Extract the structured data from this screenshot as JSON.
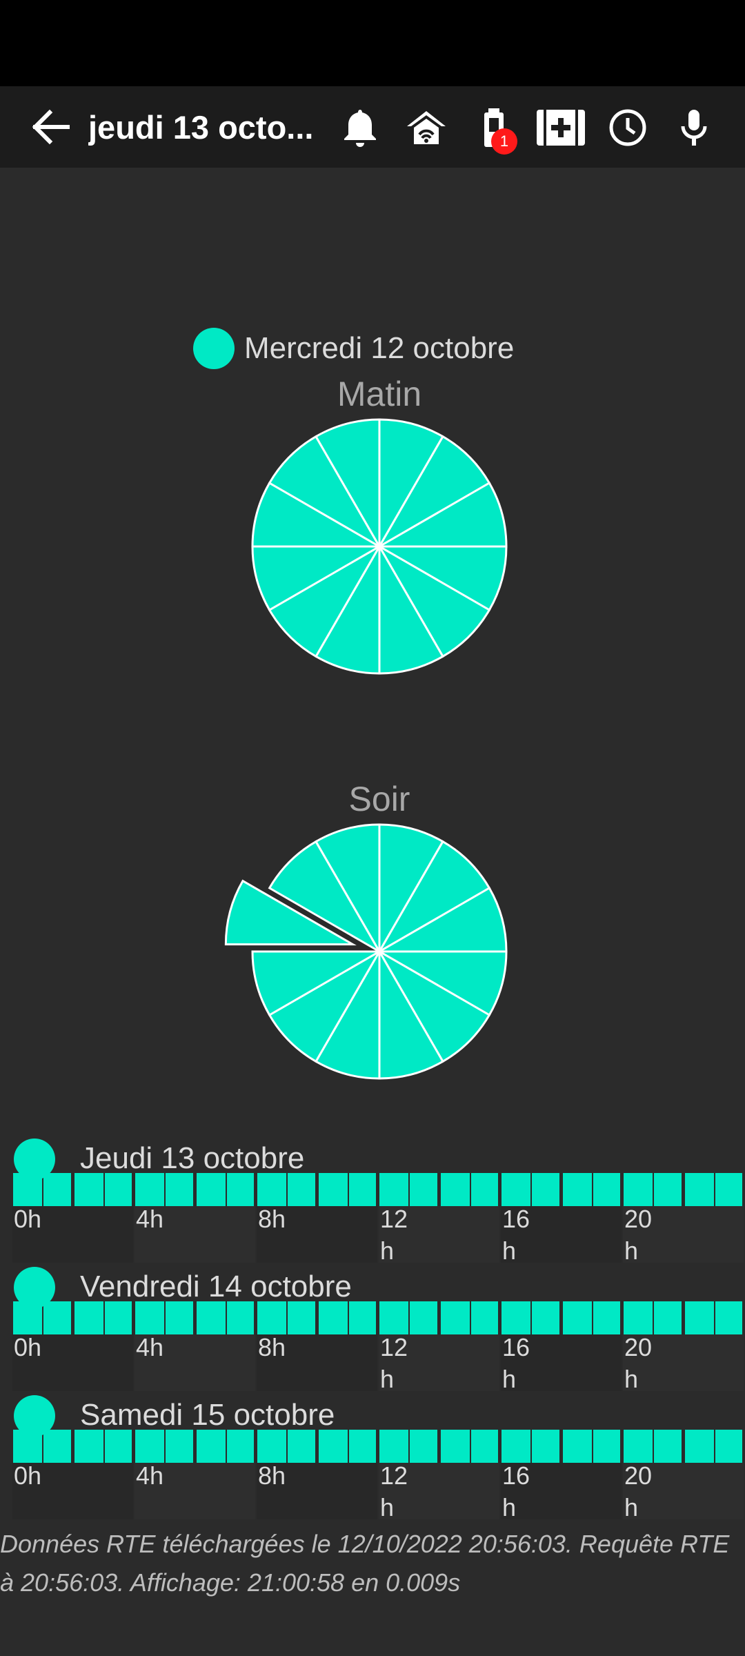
{
  "toolbar": {
    "title": "jeudi 13 octo...",
    "back_icon": "arrow-left-icon",
    "icons": [
      "bell-icon",
      "home-icon",
      "battery-icon",
      "medical-case-icon",
      "clock-icon",
      "microphone-icon"
    ],
    "battery_badge": "1"
  },
  "legend": {
    "label": "Mercredi 12 octobre",
    "color": "#00e9c5"
  },
  "chart_data": [
    {
      "type": "pie",
      "title": "Matin",
      "slices": 12,
      "values": [
        1,
        1,
        1,
        1,
        1,
        1,
        1,
        1,
        1,
        1,
        1,
        1
      ],
      "color": "#00e9c5"
    },
    {
      "type": "pie",
      "title": "Soir",
      "slices": 12,
      "values": [
        1,
        1,
        1,
        1,
        1,
        1,
        1,
        1,
        1,
        1,
        1,
        1
      ],
      "exploded_slice_index": 9,
      "color": "#00e9c5"
    }
  ],
  "days": [
    {
      "label": "Jeudi 13 octobre",
      "ticks": [
        "0h",
        "4h",
        "8h",
        "12 h",
        "16 h",
        "20 h"
      ],
      "hours_filled": 24
    },
    {
      "label": "Vendredi 14 octobre",
      "ticks": [
        "0h",
        "4h",
        "8h",
        "12 h",
        "16 h",
        "20 h"
      ],
      "hours_filled": 24
    },
    {
      "label": "Samedi 15 octobre",
      "ticks": [
        "0h",
        "4h",
        "8h",
        "12 h",
        "16 h",
        "20 h"
      ],
      "hours_filled": 24
    }
  ],
  "footer": {
    "text": "Données RTE téléchargées le 12/10/2022 20:56:03. Requête RTE à 20:56:03. Affichage: 21:00:58 en 0.009s"
  }
}
